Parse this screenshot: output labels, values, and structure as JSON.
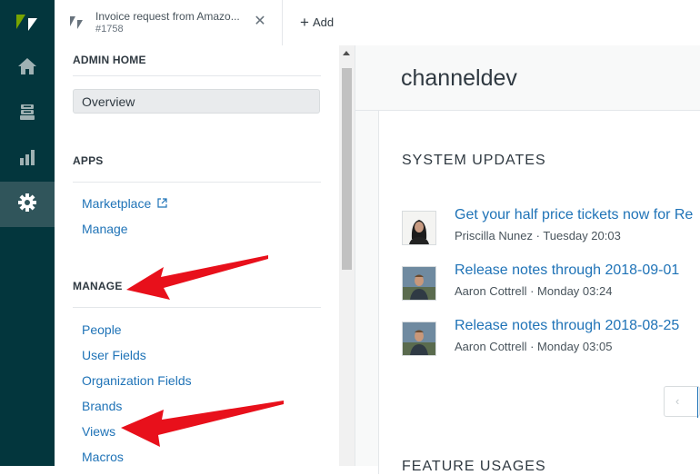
{
  "tab": {
    "title": "Invoice request from Amazo...",
    "subtitle": "#1758",
    "close_label": "✕"
  },
  "add_button": {
    "label": "Add"
  },
  "sidebar": {
    "sections": [
      {
        "heading": "ADMIN HOME"
      },
      {
        "heading": "APPS"
      },
      {
        "heading": "MANAGE"
      }
    ],
    "overview_label": "Overview",
    "apps_links": [
      "Marketplace",
      "Manage"
    ],
    "manage_links": [
      "People",
      "User Fields",
      "Organization Fields",
      "Brands",
      "Views",
      "Macros"
    ]
  },
  "main": {
    "title": "channeldev",
    "system_updates_title": "SYSTEM UPDATES",
    "updates": [
      {
        "title": "Get your half price tickets now for Re",
        "author": "Priscilla Nunez",
        "time": "Tuesday 20:03"
      },
      {
        "title": "Release notes through 2018-09-01",
        "author": "Aaron Cottrell",
        "time": "Monday 03:24"
      },
      {
        "title": "Release notes through 2018-08-25",
        "author": "Aaron Cottrell",
        "time": "Monday 03:05"
      }
    ],
    "pager_prev": "‹",
    "feature_usages_title": "FEATURE USAGES"
  },
  "colors": {
    "rail": "#03363d",
    "rail_active": "#30555b",
    "logo_accent": "#78a300",
    "link": "#1f73b7",
    "annotation_arrow": "#e8101b"
  },
  "icons": [
    "zendesk-logo-icon",
    "home-icon",
    "views-icon",
    "reporting-icon",
    "gear-icon",
    "external-link-icon",
    "plus-icon",
    "close-icon"
  ]
}
